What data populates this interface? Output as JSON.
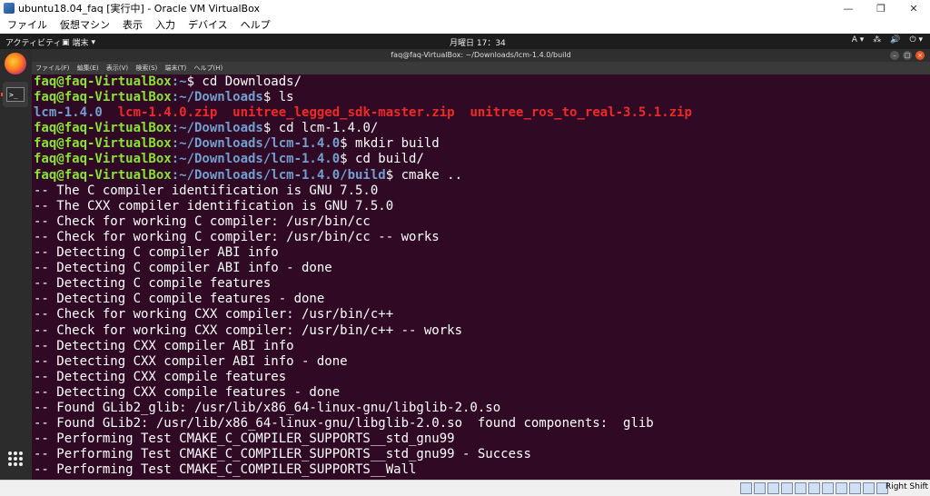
{
  "host_window": {
    "title": "ubuntu18.04_faq [実行中] - Oracle VM VirtualBox",
    "controls": {
      "minimize": "—",
      "restore": "❐",
      "close": "✕"
    },
    "menu": [
      "ファイル",
      "仮想マシン",
      "表示",
      "入力",
      "デバイス",
      "ヘルプ"
    ]
  },
  "guest_topbar": {
    "activities": "アクティビティ",
    "app_menu": "端末",
    "clock": "月曜日 17：34",
    "tray": [
      "A ▾",
      "⁂",
      "🔊",
      "⏻ ▾"
    ]
  },
  "dock": {
    "items": [
      {
        "name": "firefox",
        "icon": "firefox-icon"
      },
      {
        "name": "terminal",
        "icon": "terminal-icon",
        "glyph": ">_"
      }
    ],
    "show_apps_icon": "apps-grid-icon"
  },
  "terminal": {
    "title": "faq@faq-VirtualBox: ~/Downloads/lcm-1.4.0/build",
    "menu": [
      "ファイル(F)",
      "編集(E)",
      "表示(V)",
      "検索(S)",
      "端末(T)",
      "ヘルプ(H)"
    ],
    "colors": {
      "background": "#300a24",
      "user": "#8ae234",
      "path": "#729fcf",
      "zip": "#ef2929"
    },
    "prompt_user": "faq@faq-VirtualBox",
    "lines": [
      {
        "path": ":~",
        "cmd": "$ cd Downloads/"
      },
      {
        "path": ":~/Downloads",
        "cmd": "$ ls"
      },
      {
        "listing": {
          "dir": "lcm-1.4.0",
          "files": [
            "lcm-1.4.0.zip",
            "unitree_legged_sdk-master.zip",
            "unitree_ros_to_real-3.5.1.zip"
          ]
        }
      },
      {
        "path": ":~/Downloads",
        "cmd": "$ cd lcm-1.4.0/"
      },
      {
        "path": ":~/Downloads/lcm-1.4.0",
        "cmd": "$ mkdir build"
      },
      {
        "path": ":~/Downloads/lcm-1.4.0",
        "cmd": "$ cd build/"
      },
      {
        "path": ":~/Downloads/lcm-1.4.0/build",
        "cmd": "$ cmake .."
      },
      {
        "text": "-- The C compiler identification is GNU 7.5.0"
      },
      {
        "text": "-- The CXX compiler identification is GNU 7.5.0"
      },
      {
        "text": "-- Check for working C compiler: /usr/bin/cc"
      },
      {
        "text": "-- Check for working C compiler: /usr/bin/cc -- works"
      },
      {
        "text": "-- Detecting C compiler ABI info"
      },
      {
        "text": "-- Detecting C compiler ABI info - done"
      },
      {
        "text": "-- Detecting C compile features"
      },
      {
        "text": "-- Detecting C compile features - done"
      },
      {
        "text": "-- Check for working CXX compiler: /usr/bin/c++"
      },
      {
        "text": "-- Check for working CXX compiler: /usr/bin/c++ -- works"
      },
      {
        "text": "-- Detecting CXX compiler ABI info"
      },
      {
        "text": "-- Detecting CXX compiler ABI info - done"
      },
      {
        "text": "-- Detecting CXX compile features"
      },
      {
        "text": "-- Detecting CXX compile features - done"
      },
      {
        "text": "-- Found GLib2_glib: /usr/lib/x86_64-linux-gnu/libglib-2.0.so"
      },
      {
        "text": "-- Found GLib2: /usr/lib/x86_64-linux-gnu/libglib-2.0.so  found components:  glib"
      },
      {
        "text": "-- Performing Test CMAKE_C_COMPILER_SUPPORTS__std_gnu99"
      },
      {
        "text": "-- Performing Test CMAKE_C_COMPILER_SUPPORTS__std_gnu99 - Success"
      },
      {
        "text": "-- Performing Test CMAKE_C_COMPILER_SUPPORTS__Wall"
      }
    ]
  },
  "host_statusbar": {
    "host_key": "Right Shift",
    "indicator_icons": [
      "hdd-icon",
      "optical-drive-icon",
      "audio-icon",
      "network-icon",
      "usb-icon",
      "shared-folder-icon",
      "display-icon",
      "video-capture-icon",
      "cpu-icon",
      "globe-icon",
      "mouse-integration-icon"
    ]
  }
}
